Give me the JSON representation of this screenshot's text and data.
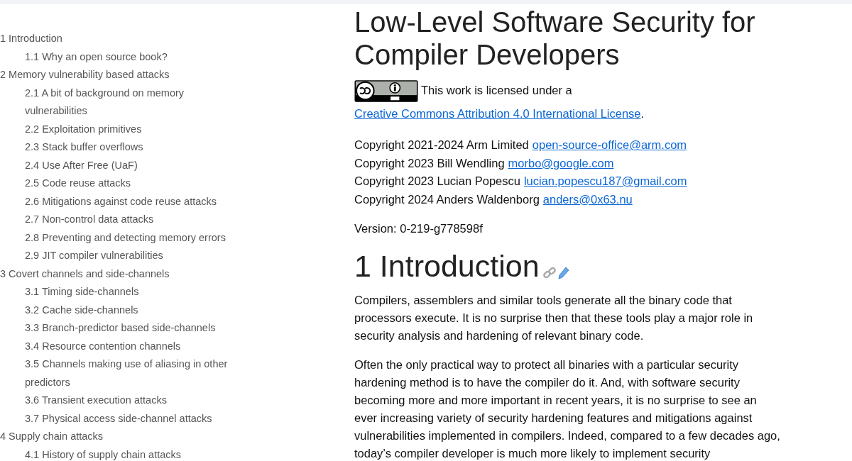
{
  "toc": [
    {
      "label": "1 Introduction",
      "children": [
        {
          "label": "1.1 Why an open source book?"
        }
      ]
    },
    {
      "label": "2 Memory vulnerability based attacks",
      "children": [
        {
          "label": "2.1 A bit of background on memory vulnerabilities"
        },
        {
          "label": "2.2 Exploitation primitives"
        },
        {
          "label": "2.3 Stack buffer overflows"
        },
        {
          "label": "2.4 Use After Free (UaF)"
        },
        {
          "label": "2.5 Code reuse attacks"
        },
        {
          "label": "2.6 Mitigations against code reuse attacks"
        },
        {
          "label": "2.7 Non-control data attacks"
        },
        {
          "label": "2.8 Preventing and detecting memory errors"
        },
        {
          "label": "2.9 JIT compiler vulnerabilities"
        }
      ]
    },
    {
      "label": "3 Covert channels and side-channels",
      "children": [
        {
          "label": "3.1 Timing side-channels"
        },
        {
          "label": "3.2 Cache side-channels"
        },
        {
          "label": "3.3 Branch-predictor based side-channels"
        },
        {
          "label": "3.4 Resource contention channels"
        },
        {
          "label": "3.5 Channels making use of aliasing in other predictors"
        },
        {
          "label": "3.6 Transient execution attacks"
        },
        {
          "label": "3.7 Physical access side-channel attacks"
        }
      ]
    },
    {
      "label": "4 Supply chain attacks",
      "children": [
        {
          "label": "4.1 History of supply chain attacks"
        }
      ]
    }
  ],
  "title": "Low-Level Software Security for Compiler Developers",
  "license": {
    "before": "This work is licensed under a ",
    "link": "Creative Commons Attribution 4.0 International License",
    "after": "."
  },
  "copyrights": [
    {
      "text": "Copyright 2021-2024 Arm Limited",
      "email": "open-source-office@arm.com"
    },
    {
      "text": "Copyright 2023 Bill Wendling",
      "email": "morbo@google.com"
    },
    {
      "text": "Copyright 2023 Lucian Popescu",
      "email": "lucian.popescu187@gmail.com"
    },
    {
      "text": "Copyright 2024 Anders Waldenborg",
      "email": "anders@0x63.nu"
    }
  ],
  "version": "Version: 0-219-g778598f",
  "section_heading": "1 Introduction",
  "paragraphs": [
    "Compilers, assemblers and similar tools generate all the binary code that processors execute. It is no surprise then that these tools play a major role in security analysis and hardening of relevant binary code.",
    "Often the only practical way to protect all binaries with a particular security hardening method is to have the compiler do it. And, with software security becoming more and more important in recent years, it is no surprise to see an ever increasing variety of security hardening features and mitigations against vulnerabilities implemented in compilers. Indeed, compared to a few decades ago, today’s compiler developer is much more likely to implement security"
  ]
}
